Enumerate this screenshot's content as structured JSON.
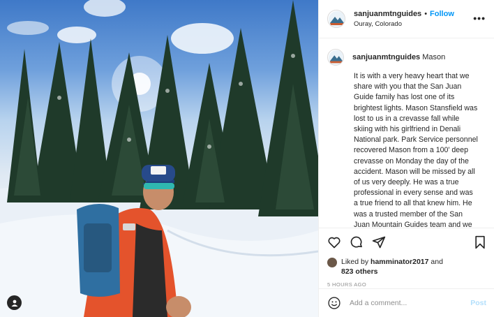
{
  "post": {
    "user_tag_icon": "person-icon",
    "header": {
      "username": "sanjuanmtnguides",
      "separator": "•",
      "follow_label": "Follow",
      "location": "Ouray, Colorado",
      "more_icon": "more-horizontal-icon",
      "more_label": "•••"
    },
    "caption": {
      "username": "sanjuanmtnguides",
      "title": "Mason",
      "text": "It is with a very heavy heart that we share with you that the San Juan Guide family has lost one of its brightest lights. Mason Stansfield was lost to us in a crevasse fall while skiing with his girlfriend in Denali National park. Park Service personnel recovered Mason from a 100' deep crevasse on Monday the day of the accident. Mason will be missed by all of us very deeply. He was a true professional in every sense and was a true friend to all that knew him. He was a trusted member of the San Juan Mountain Guides team and we considered him a \"Swiss Army Knife Guide\", capable"
    },
    "actions": {
      "like_icon": "heart-icon",
      "comment_icon": "comment-icon",
      "share_icon": "share-icon",
      "save_icon": "bookmark-icon"
    },
    "likes": {
      "prefix": "Liked by",
      "user": "hamminator2017",
      "joiner": "and",
      "others": "823 others"
    },
    "timestamp": "5 HOURS AGO",
    "comment_box": {
      "emoji_icon": "emoji-icon",
      "placeholder": "Add a comment...",
      "post_label": "Post"
    },
    "colors": {
      "accent": "#0095f6",
      "post_disabled": "#b2dffc",
      "muted": "#8e8e8e"
    }
  }
}
